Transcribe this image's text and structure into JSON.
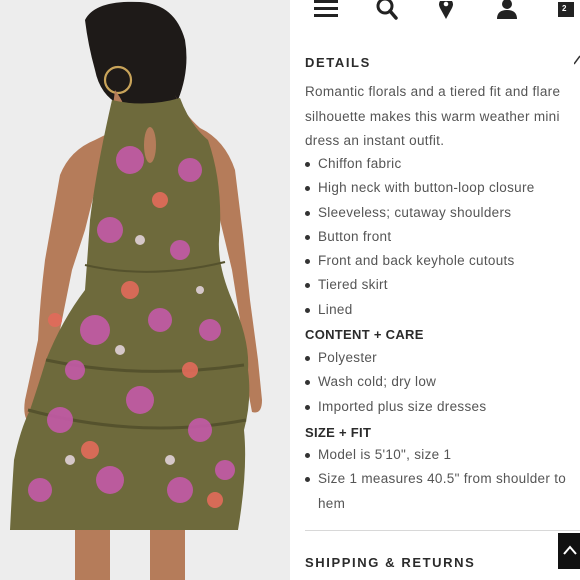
{
  "details": {
    "heading": "DETAILS",
    "description": "Romantic florals and a tiered fit and flare silhouette makes this warm weather mini dress an instant outfit.",
    "features": [
      "Chiffon fabric",
      "High neck with button-loop closure",
      "Sleeveless; cutaway shoulders",
      "Button front",
      "Front and back keyhole cutouts",
      "Tiered skirt",
      "Lined"
    ]
  },
  "content_care": {
    "heading": "CONTENT + CARE",
    "items": [
      "Polyester",
      "Wash cold; dry low",
      "Imported plus size dresses"
    ]
  },
  "size_fit": {
    "heading": "SIZE + FIT",
    "items": [
      "Model is 5'10\", size 1",
      "Size 1 measures 40.5\" from shoulder to hem"
    ]
  },
  "shipping": {
    "heading": "SHIPPING & RETURNS"
  },
  "header": {
    "cart_count": "2"
  },
  "icons": [
    "menu-icon",
    "search-icon",
    "location-pin-icon",
    "account-icon",
    "cart-icon",
    "chevron-up-icon",
    "chevron-right-icon"
  ],
  "colors": {
    "dress": "#6e6a3c",
    "text": "#555555",
    "heading": "#2b2b2b"
  }
}
